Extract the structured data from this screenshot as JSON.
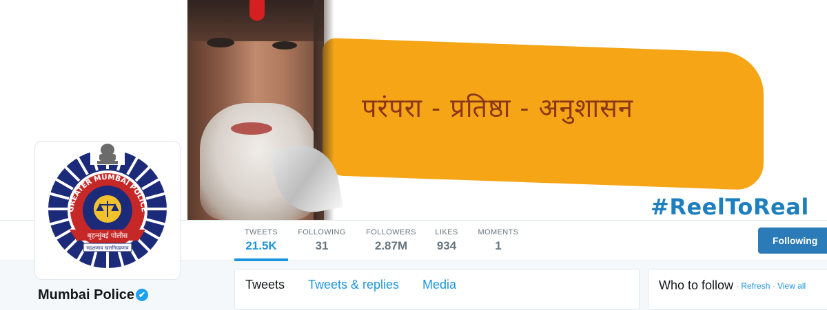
{
  "banner": {
    "slogan": "परंपरा - प्रतिष्ठा - अनुशासन",
    "hashtag": "#ReelToReal"
  },
  "profile": {
    "name": "Mumbai Police",
    "verified_glyph": "✔",
    "avatar": {
      "ring_text": "GREATER MUMBAI POLICE",
      "banner_text": "बृहन्मुंबई पोलीस",
      "motto": "सद्रक्षणाय खलनिग्रहणाय"
    }
  },
  "stats": [
    {
      "label": "TWEETS",
      "value": "21.5K"
    },
    {
      "label": "FOLLOWING",
      "value": "31"
    },
    {
      "label": "FOLLOWERS",
      "value": "2.87M"
    },
    {
      "label": "LIKES",
      "value": "934"
    },
    {
      "label": "MOMENTS",
      "value": "1"
    }
  ],
  "follow_button": "Following",
  "tabs": [
    "Tweets",
    "Tweets & replies",
    "Media"
  ],
  "who_to_follow": {
    "title": "Who to follow",
    "separator": "·",
    "refresh": "Refresh",
    "view_all": "View all"
  },
  "colors": {
    "accent": "#1b95e0",
    "button": "#2b7bb9",
    "banner_orange": "#f5a516",
    "logo_navy": "#1c2a7a",
    "logo_red": "#c62828",
    "logo_gold": "#f2c12e"
  }
}
